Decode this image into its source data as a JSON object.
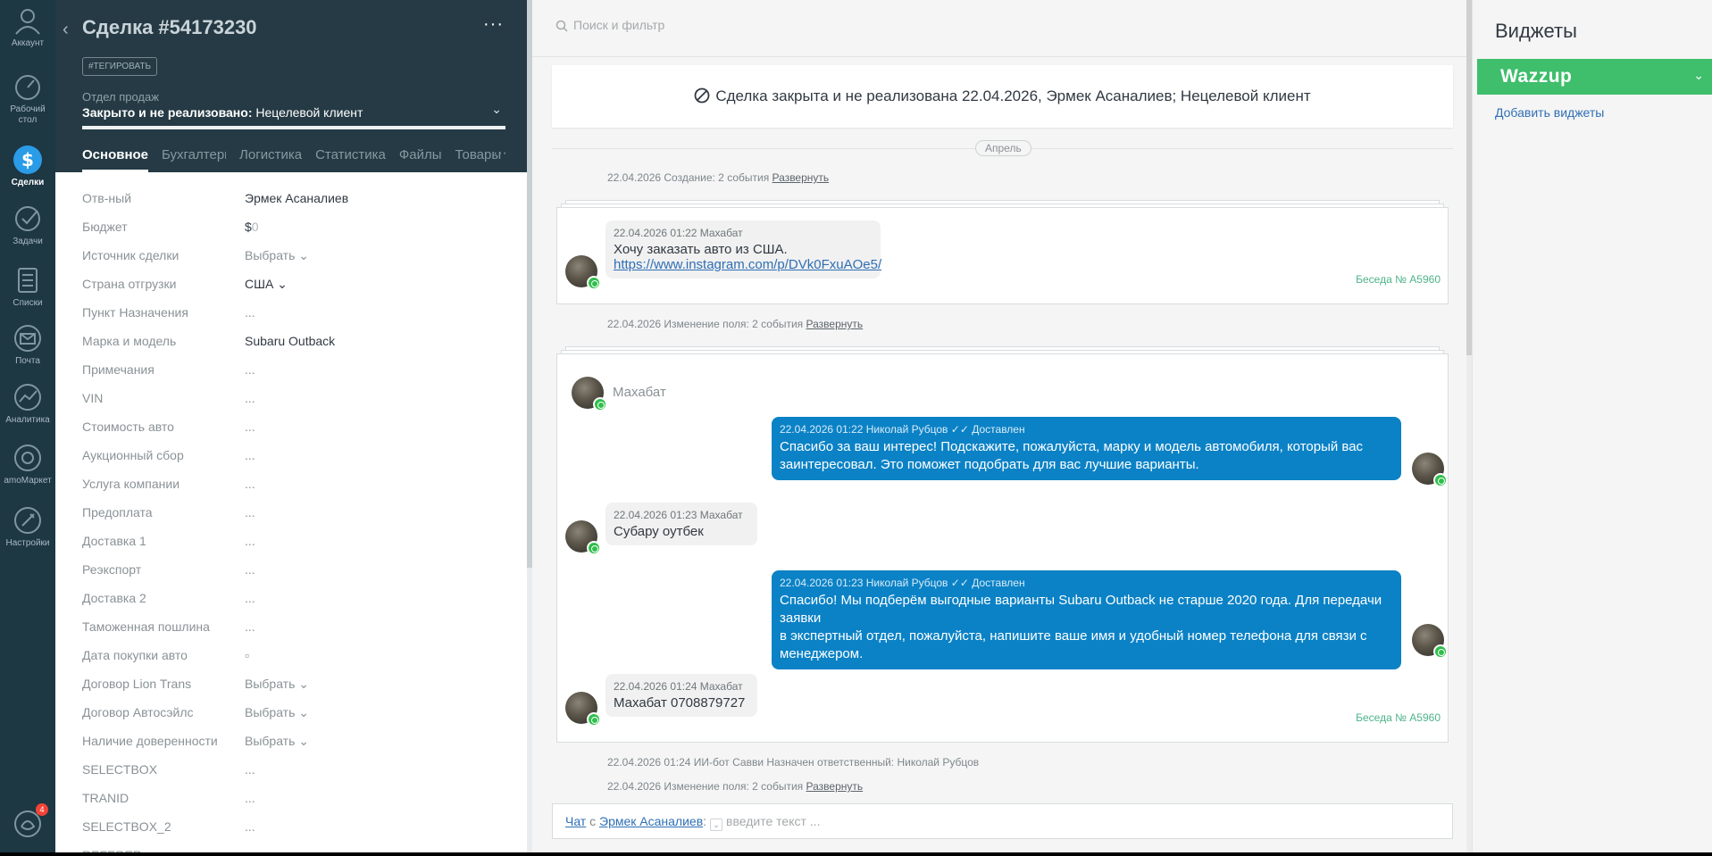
{
  "nav": {
    "items": [
      {
        "label": "Аккаунт",
        "icon": "user-icon"
      },
      {
        "label": "Рабочий стол",
        "icon": "dashboard-icon"
      },
      {
        "label": "Сделки",
        "icon": "deals-icon"
      },
      {
        "label": "Задачи",
        "icon": "tasks-icon"
      },
      {
        "label": "Списки",
        "icon": "lists-icon"
      },
      {
        "label": "Почта",
        "icon": "mail-icon"
      },
      {
        "label": "Аналитика",
        "icon": "analytics-icon"
      },
      {
        "label": "amoМаркет",
        "icon": "market-icon"
      },
      {
        "label": "Настройки",
        "icon": "settings-icon"
      }
    ],
    "chat_badge": "4"
  },
  "card": {
    "title": "Сделка #54173230",
    "more": "···",
    "tag_button": "#ТЕГИРОВАТЬ",
    "pipeline_label": "Отдел продаж",
    "status_bold": "Закрыто и не реализовано:",
    "status_reason": " Нецелевой клиент",
    "tabs": [
      "Основное",
      "Бухгалтерия",
      "Логистика",
      "Статистика",
      "Файлы",
      "Товары"
    ],
    "tabs_more": "···",
    "fields": [
      {
        "label": "Отв-ный",
        "value": "Эрмек Асаналиев"
      },
      {
        "label": "Бюджет",
        "value": "$",
        "dim": "0"
      },
      {
        "label": "Источник сделки",
        "value": "Выбрать ⌄"
      },
      {
        "label": "Страна отгрузки",
        "value": "США ⌄"
      },
      {
        "label": "Пункт Назначения",
        "value": "..."
      },
      {
        "label": "Марка и модель",
        "value": "Subaru Outback"
      },
      {
        "label": "Примечания",
        "value": "..."
      },
      {
        "label": "VIN",
        "value": "..."
      },
      {
        "label": "Стоимость авто",
        "value": "..."
      },
      {
        "label": "Аукционный сбор",
        "value": "..."
      },
      {
        "label": "Услуга компании",
        "value": "..."
      },
      {
        "label": "Предоплата",
        "value": "..."
      },
      {
        "label": "Доставка 1",
        "value": "..."
      },
      {
        "label": "Реэкспорт",
        "value": "..."
      },
      {
        "label": "Доставка 2",
        "value": "..."
      },
      {
        "label": "Таможенная пошлина",
        "value": "..."
      },
      {
        "label": "Дата покупки авто",
        "value": "▫"
      },
      {
        "label": "Договор Lion Trans",
        "value": "Выбрать ⌄"
      },
      {
        "label": "Договор Автосэйлс",
        "value": "Выбрать ⌄"
      },
      {
        "label": "Наличие доверенности",
        "value": "Выбрать ⌄"
      },
      {
        "label": "SELECTBOX",
        "value": "..."
      },
      {
        "label": "TRANID",
        "value": "..."
      },
      {
        "label": "SELECTBOX_2",
        "value": "..."
      },
      {
        "label": "REFERER",
        "value": ""
      }
    ]
  },
  "feed": {
    "search_placeholder": "Поиск и фильтр",
    "closed_banner": "Сделка закрыта и не реализована 22.04.2026, Эрмек Асаналиев; Нецелевой клиент",
    "month": "Апрель",
    "event1": "22.04.2026 Создание: 2 события",
    "event1_link": "Развернуть",
    "chat1": {
      "meta": "22.04.2026 01:22 Махабат",
      "text": "Хочу заказать авто из США.",
      "link": "https://www.instagram.com/p/DVk0FxuAOe5/",
      "conv": "Беседа № A5960"
    },
    "event2": "22.04.2026 Изменение поля: 2 события",
    "event2_link": "Развернуть",
    "chat2": {
      "sender": "Махабат",
      "out1_meta": "22.04.2026 01:22 Николай Рубцов",
      "out1_status": "Доставлен",
      "out1_line1": "Спасибо за ваш интерес! Подскажите, пожалуйста, марку и модель автомобиля, который вас",
      "out1_line2": "заинтересовал. Это поможет подобрать для вас лучшие варианты.",
      "in1_meta": "22.04.2026 01:23 Махабат",
      "in1_text": "Субару оутбек",
      "out2_meta": "22.04.2026 01:23 Николай Рубцов",
      "out2_status": "Доставлен",
      "out2_line1": "Спасибо! Мы подберём выгодные варианты Subaru Outback не старше 2020 года. Для передачи заявки",
      "out2_line2": "в экспертный отдел, пожалуйста, напишите ваше имя и удобный номер телефона для связи с",
      "out2_line3": "менеджером.",
      "in2_meta": "22.04.2026 01:24 Махабат",
      "in2_text": "Махабат 0708879727",
      "conv": "Беседа № A5960"
    },
    "event3": "22.04.2026 01:24 ИИ-бот Савви Назначен ответственный: Николай Рубцов",
    "event4": "22.04.2026 Изменение поля: 2 события",
    "event4_link": "Развернуть",
    "composer": {
      "chat_link": "Чат",
      "with": " с ",
      "contact_link": "Эрмек Асаналиев",
      "colon": ":",
      "placeholder": "введите текст ..."
    }
  },
  "widgets": {
    "title": "Виджеты",
    "wazzup": "Wazzup",
    "add": "Добавить виджеты"
  },
  "colors": {
    "nav_bg": "#1d3743",
    "card_head_bg": "#253a44",
    "outgoing_bubble": "#0b82c6",
    "wazzup_green": "#3fbe6c",
    "link_blue": "#2f6fb5"
  }
}
